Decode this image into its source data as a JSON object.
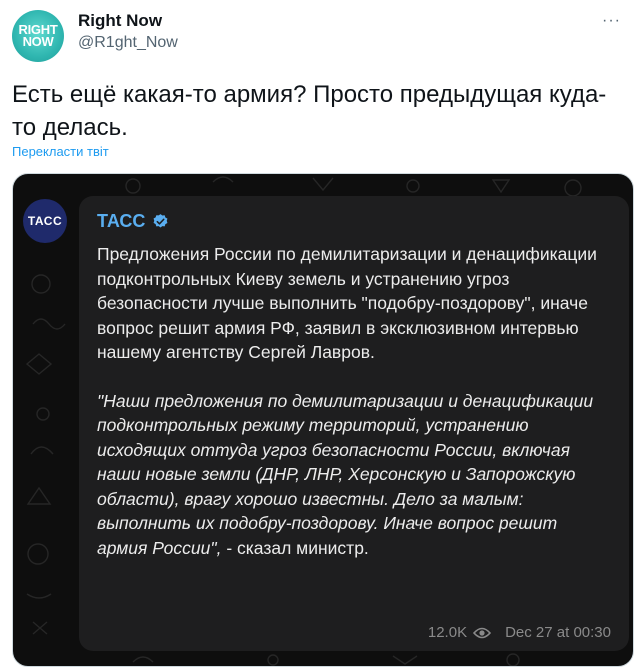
{
  "tweet": {
    "avatar_text_line1": "RIGHT",
    "avatar_text_line2": "NOW",
    "display_name": "Right Now",
    "handle": "@R1ght_Now",
    "more_label": "···",
    "text": "Есть ещё какая-то армия? Просто предыдущая куда-то делась.",
    "translate_label": "Перекласти твіт"
  },
  "telegram_post": {
    "channel_avatar_text": "ТАСС",
    "channel_name": "ТАСС",
    "verified_icon": "verified-check-icon",
    "body": "Предложения России по демилитаризации и денацификации подконтрольных Киеву земель и устранению угроз безопасности лучше выполнить \"подобру-поздорову\", иначе вопрос решит армия РФ, заявил в эксклюзивном интервью нашему агентству Сергей Лавров.",
    "quote": "\"Наши предложения по демилитаризации и денацификации подконтрольных режиму территорий, устранению исходящих оттуда угроз безопасности России, включая наши новые земли (ДНР, ЛНР, Херсонскую и Запорожскую области), врагу хорошо известны. Дело за малым: выполнить их подобру-поздорову. Иначе вопрос решит армия России\",",
    "quote_tail": " - сказал министр.",
    "views": "12.0K",
    "eye_icon": "eye-icon",
    "timestamp": "Dec 27 at 00:30"
  },
  "colors": {
    "accent_link": "#1d9bf0",
    "telegram_bg": "#0e0e0e",
    "bubble_bg": "#1e1e1f",
    "channel_name": "#5aaef0",
    "avatar_teal": "#2fb6b0",
    "tass_blue": "#1f2a6b"
  }
}
